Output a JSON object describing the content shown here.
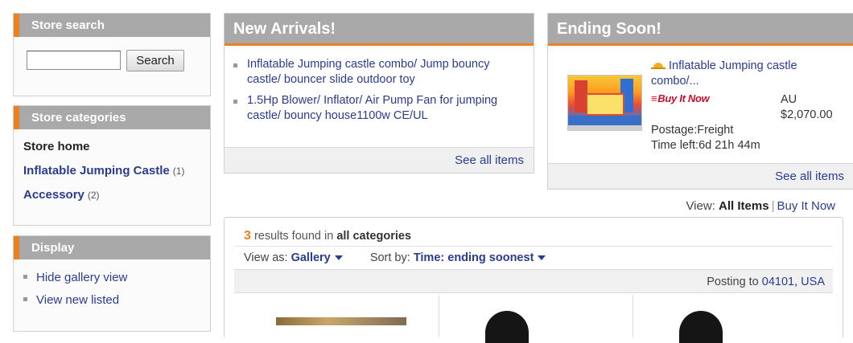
{
  "store_search": {
    "title": "Store search",
    "input_value": "",
    "button_label": "Search"
  },
  "store_categories": {
    "title": "Store categories",
    "home_label": "Store home",
    "items": [
      {
        "label": "Inflatable Jumping Castle",
        "count": "(1)"
      },
      {
        "label": "Accessory",
        "count": "(2)"
      }
    ]
  },
  "display": {
    "title": "Display",
    "items": [
      "Hide gallery view",
      "View new listed"
    ]
  },
  "new_arrivals": {
    "title": "New Arrivals!",
    "items": [
      "Inflatable Jumping castle combo/ Jump bouncy castle/ bouncer slide outdoor toy",
      "1.5Hp Blower/ Inflator/ Air Pump Fan for jumping castle/ bouncy house1100w CE/UL"
    ],
    "see_all": "See all items"
  },
  "ending_soon": {
    "title": "Ending Soon!",
    "item_title": "Inflatable Jumping castle combo/...",
    "buy_it_now_logo": "Buy It Now",
    "currency": "AU",
    "price": "$2,070.00",
    "postage": "Postage:Freight",
    "time_left": "Time left:6d 21h 44m",
    "see_all": "See all items"
  },
  "view_row": {
    "label": "View:",
    "all_items": "All Items",
    "separator": "|",
    "buy_it_now": "Buy It Now"
  },
  "results": {
    "count": "3",
    "found_text": "results found in",
    "scope": "all categories",
    "view_as_label": "View as:",
    "view_as_value": "Gallery",
    "sort_label": "Sort by:",
    "sort_value": "Time: ending soonest",
    "posting_to_label": "Posting to",
    "posting_to_value": "04101, USA"
  },
  "colors": {
    "accent": "#ee7f1f",
    "header_gray": "#a9a9a9",
    "link": "#2b3b8f"
  }
}
